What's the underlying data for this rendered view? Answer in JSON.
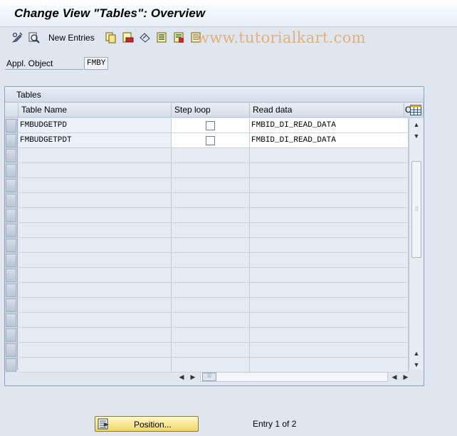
{
  "window": {
    "title": "Change View \"Tables\": Overview"
  },
  "toolbar": {
    "new_entries_label": "New Entries",
    "watermark": "www.tutorialkart.com",
    "icons": [
      "display-change-icon",
      "find-icon",
      "copy-icon",
      "delete-icon",
      "undo-icon",
      "select-all-icon",
      "select-block-icon",
      "deselect-all-icon"
    ]
  },
  "selection": {
    "label": "Appl. Object",
    "value": "FMBY"
  },
  "table": {
    "title": "Tables",
    "columns": {
      "name": "Table Name",
      "step_loop": "Step loop",
      "read_data": "Read data",
      "next": "C"
    },
    "rows": [
      {
        "name": "FMBUDGETPD",
        "step_loop": false,
        "read_data": "FMBID_DI_READ_DATA"
      },
      {
        "name": "FMBUDGETPDT",
        "step_loop": false,
        "read_data": "FMBID_DI_READ_DATA"
      }
    ],
    "empty_row_count": 15
  },
  "footer": {
    "position_label": "Position...",
    "entry_info": "Entry 1 of 2"
  },
  "colors": {
    "background": "#dfe6ef",
    "button_yellow": "#f1d766",
    "watermark": "#e2b07a"
  }
}
